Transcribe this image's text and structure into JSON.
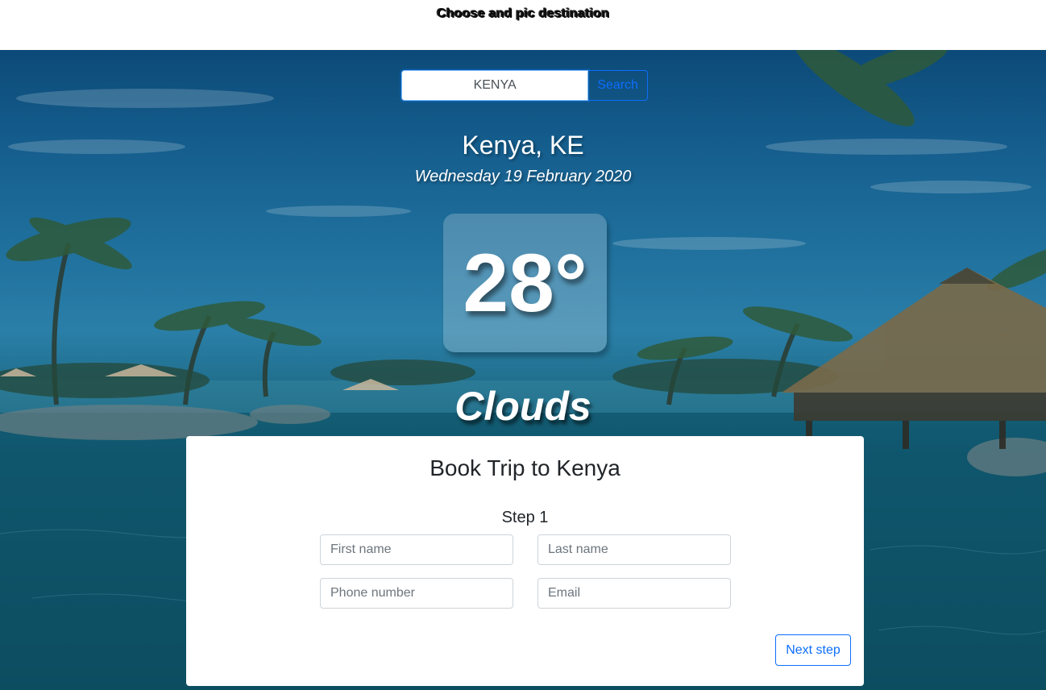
{
  "header": {
    "title": "Choose and pic destination"
  },
  "search": {
    "value": "KENYA",
    "button_label": "Search"
  },
  "weather": {
    "location": "Kenya, KE",
    "date": "Wednesday 19 February 2020",
    "temperature": "28°",
    "condition": "Clouds"
  },
  "booking": {
    "title": "Book Trip to Kenya",
    "step": "Step 1",
    "fields": {
      "first_name_placeholder": "First name",
      "last_name_placeholder": "Last name",
      "phone_placeholder": "Phone number",
      "email_placeholder": "Email"
    },
    "next_label": "Next step"
  },
  "colors": {
    "accent": "#0d6efd",
    "sky": "#145c8c",
    "water": "#0e4d62"
  }
}
